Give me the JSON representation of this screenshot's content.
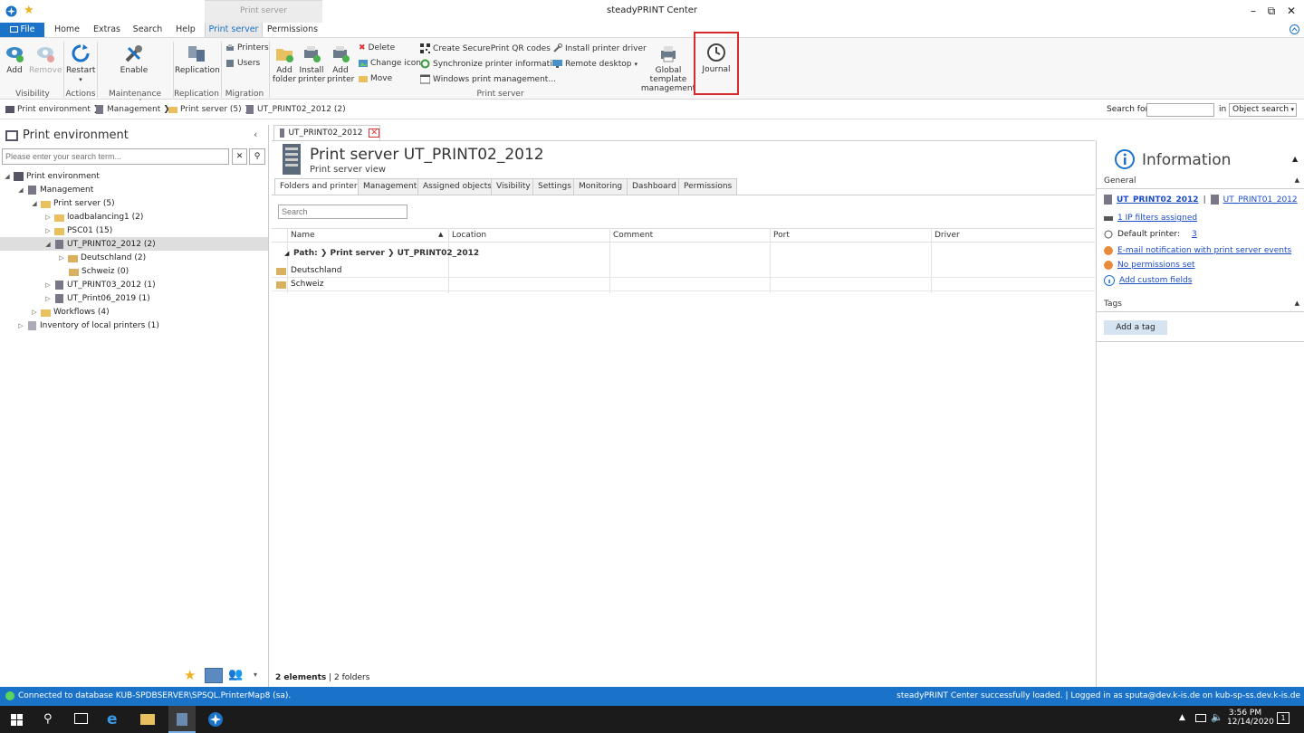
{
  "window": {
    "title": "steadyPRINT Center",
    "min": "–",
    "max": "⧉",
    "close": "✕"
  },
  "menu": {
    "file": "File",
    "tabs": [
      "Home",
      "Extras",
      "Search",
      "Help",
      "Print server",
      "Permissions"
    ],
    "context_label": "Print server"
  },
  "ribbon": {
    "add": "Add",
    "remove": "Remove",
    "restart": "Restart",
    "enable": "Enable",
    "replication": "Replication",
    "printers": "Printers",
    "users": "Users",
    "add_folder": "Add folder",
    "install_printer": "Install printer",
    "add_printer": "Add printer",
    "delete": "Delete",
    "change_icon": "Change icon",
    "move": "Move",
    "create_qr": "Create SecurePrint QR codes",
    "sync_printer": "Synchronize printer information",
    "win_print_mgmt": "Windows print management...",
    "install_driver": "Install printer driver",
    "remote_desktop": "Remote desktop",
    "global_template": "Global template management",
    "journal": "Journal",
    "groups": {
      "visibility": "Visibility",
      "actions": "Actions",
      "maintenance": "Maintenance mode",
      "replication": "Replication",
      "migration": "Migration",
      "print_server": "Print server"
    }
  },
  "breadcrumb": [
    "Print environment",
    "Management",
    "Print server (5)",
    "UT_PRINT02_2012 (2)"
  ],
  "search": {
    "label": "Search for",
    "value": "",
    "in": "in",
    "scope": "Object search"
  },
  "left": {
    "title": "Print environment",
    "placeholder": "Please enter your search term...",
    "tree": [
      {
        "label": "Print environment"
      },
      {
        "label": "Management"
      },
      {
        "label": "Print server (5)"
      },
      {
        "label": "loadbalancing1 (2)"
      },
      {
        "label": "PSC01 (15)"
      },
      {
        "label": "UT_PRINT02_2012 (2)"
      },
      {
        "label": "Deutschland (2)"
      },
      {
        "label": "Schweiz (0)"
      },
      {
        "label": "UT_PRINT03_2012 (1)"
      },
      {
        "label": "UT_Print06_2019 (1)"
      },
      {
        "label": "Workflows (4)"
      },
      {
        "label": "Inventory of local printers (1)"
      }
    ]
  },
  "doc": {
    "tab": "UT_PRINT02_2012",
    "title": "Print server UT_PRINT02_2012",
    "subtitle": "Print server view",
    "tabs": [
      "Folders and printers",
      "Management",
      "Assigned objects",
      "Visibility",
      "Settings",
      "Monitoring",
      "Dashboard",
      "Permissions"
    ],
    "search_placeholder": "Search",
    "columns": [
      "Name",
      "Location",
      "Comment",
      "Port",
      "Driver"
    ],
    "path": "Path: ❯ Print server ❯ UT_PRINT02_2012",
    "rows": [
      {
        "name": "Deutschland"
      },
      {
        "name": "Schweiz"
      }
    ],
    "count": "2 elements",
    "count_detail": "| 2 folders"
  },
  "info": {
    "title": "Information",
    "general": "General",
    "server1": "UT_PRINT02_2012",
    "server2": "UT_PRINT01_2012",
    "sep": "|",
    "ip_filters": "1 IP filters assigned",
    "default_label": "Default printer:",
    "default_value": "3",
    "email": "E-mail notification with print server events",
    "perms": "No permissions set",
    "custom": "Add custom fields",
    "tags": "Tags",
    "add_tag": "Add a tag"
  },
  "status": {
    "left": "Connected to database KUB-SPDBSERVER\\SPSQL.PrinterMap8 (sa).",
    "right": "steadyPRINT Center successfully loaded. | Logged in as sputa@dev.k-is.de on kub-sp-ss.dev.k-is.de"
  },
  "taskbar": {
    "time": "3:56 PM",
    "date": "12/14/2020",
    "notif": "1"
  },
  "colors": {
    "accent": "#1a73c8",
    "highlight": "#d92b2b",
    "orange": "#e88a3a"
  }
}
